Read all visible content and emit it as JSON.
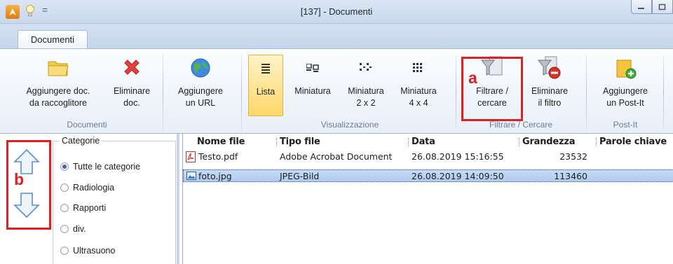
{
  "window": {
    "title": "[137] - Documenti",
    "qa_separator": "="
  },
  "tabs": [
    {
      "label": "Documenti"
    }
  ],
  "ribbon": {
    "groups": {
      "documenti": {
        "label": "Documenti",
        "add_from_collector": {
          "line1": "Aggiungere doc.",
          "line2": "da raccoglitore"
        },
        "delete": {
          "line1": "Eliminare",
          "line2": "doc."
        }
      },
      "url": {
        "add_url": {
          "line1": "Aggiungere",
          "line2": "un URL"
        }
      },
      "visualizzazione": {
        "label": "Visualizzazione",
        "list": {
          "line1": "Lista"
        },
        "thumb": {
          "line1": "Miniatura"
        },
        "thumb2": {
          "line1": "Miniatura",
          "line2": "2 x 2"
        },
        "thumb4": {
          "line1": "Miniatura",
          "line2": "4 x 4"
        }
      },
      "filtrare": {
        "label": "Filtrare / Cercare",
        "filter": {
          "line1": "Filtrare /",
          "line2": "cercare"
        },
        "remove_filter": {
          "line1": "Eliminare",
          "line2": "il filtro"
        }
      },
      "postit": {
        "label": "Post-It",
        "add_postit": {
          "line1": "Aggiungere",
          "line2": "un Post-It"
        }
      }
    }
  },
  "annotations": {
    "a": "a",
    "b": "b",
    "color": "#e02020"
  },
  "categories": {
    "legend": "Categorie",
    "options": [
      {
        "label": "Tutte le categorie",
        "selected": true
      },
      {
        "label": "Radiologia",
        "selected": false
      },
      {
        "label": "Rapporti",
        "selected": false
      },
      {
        "label": "div.",
        "selected": false
      },
      {
        "label": "Ultrasuono",
        "selected": false
      }
    ]
  },
  "filelist": {
    "columns": [
      "Nome file",
      "Tipo file",
      "Data",
      "Grandezza",
      "Parole chiave"
    ],
    "rows": [
      {
        "icon": "pdf-icon",
        "name": "Testo.pdf",
        "type": "Adobe Acrobat Document",
        "date": "26.08.2019 15:16:55",
        "size": "23532",
        "keywords": "",
        "selected": false
      },
      {
        "icon": "image-icon",
        "name": "foto.jpg",
        "type": "JPEG-Bild",
        "date": "26.08.2019 14:09:50",
        "size": "113460",
        "keywords": "",
        "selected": true
      }
    ]
  }
}
